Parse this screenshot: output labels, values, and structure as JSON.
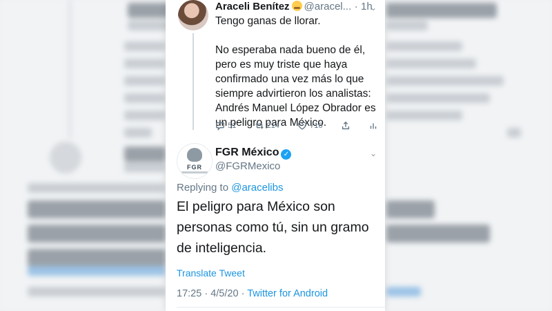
{
  "parent_tweet": {
    "name": "Araceli Benítez",
    "handle": "@aracel...",
    "separator": "·",
    "time": "1h",
    "text_lines": [
      "Tengo ganas de llorar.",
      "",
      "No esperaba nada bueno de él,",
      "pero es muy triste que haya",
      "confirmado una vez más lo que",
      "siempre advirtieron los analistas:",
      "Andrés Manuel López Obrador es",
      "un peligro para México."
    ],
    "replies": "51",
    "retweets": "214",
    "likes": "716"
  },
  "main_tweet": {
    "logo_text": "FGR",
    "name": "FGR México",
    "verified_mark": "✓",
    "handle": "@FGRMexico",
    "replying_to_label": "Replying to",
    "replying_to_user": "@aracelibs",
    "text_lines": [
      "El peligro para México son",
      "personas como tú, sin un gramo",
      "de inteligencia."
    ],
    "translate_label": "Translate Tweet",
    "time": "17:25",
    "dot": "·",
    "date": "4/5/20",
    "source": "Twitter for Android"
  },
  "icons": {
    "reply": "reply-icon",
    "retweet": "retweet-icon",
    "like": "heart-icon",
    "share": "share-icon",
    "analytics": "analytics-icon",
    "chevron": "chevron-down-icon"
  },
  "colors": {
    "link": "#1b95e0",
    "verified": "#1da1f2",
    "secondary_text": "#657786"
  }
}
